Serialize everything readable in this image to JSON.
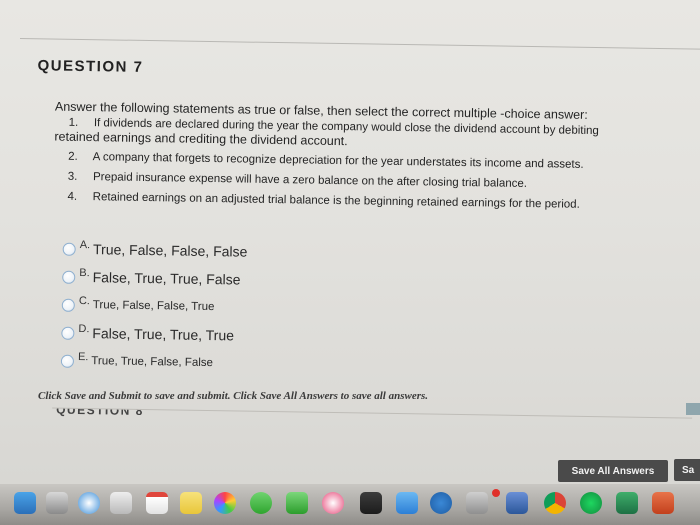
{
  "question": {
    "title": "QUESTION 7",
    "instructions": "Answer the following statements as true or false, then select the correct multiple -choice answer:",
    "statements": [
      {
        "num": "1.",
        "line1": "If dividends are declared during the year the company would close the dividend account by debiting",
        "line2": "retained earnings and crediting the dividend account."
      },
      {
        "num": "2.",
        "line1": "A company that forgets to recognize depreciation for the year understates its income and assets."
      },
      {
        "num": "3.",
        "line1": "Prepaid insurance expense will have a zero balance on the after closing trial balance."
      },
      {
        "num": "4.",
        "line1": "Retained earnings on an adjusted trial balance is the beginning retained earnings for the period."
      }
    ],
    "options": [
      {
        "letter": "A.",
        "text": "True, False, False, False"
      },
      {
        "letter": "B.",
        "text": "False, True, True, False"
      },
      {
        "letter": "C.",
        "text": "True, False, False, True"
      },
      {
        "letter": "D.",
        "text": "False, True, True, True"
      },
      {
        "letter": "E.",
        "text": "True, True, False, False"
      }
    ]
  },
  "next_question_partial": "QUESTION 8",
  "footer": {
    "note": "Click Save and Submit to save and submit. Click Save All Answers to save all answers.",
    "save_all_label": "Save All Answers",
    "save_submit_label": "Sa"
  },
  "colors": {
    "button_bg": "#4a4a4a",
    "radio_border": "#8fb0d0",
    "page_bg": "#e3e2de"
  },
  "dock": {
    "icons": [
      "finder-icon",
      "launchpad-icon",
      "safari-icon",
      "mail-icon",
      "calendar-icon",
      "notes-icon",
      "photos-icon",
      "messages-icon",
      "facetime-icon",
      "itunes-icon",
      "app-store-icon",
      "system-preferences-icon",
      "word-icon",
      "chrome-icon",
      "spotify-icon",
      "excel-icon",
      "powerpoint-icon"
    ]
  }
}
